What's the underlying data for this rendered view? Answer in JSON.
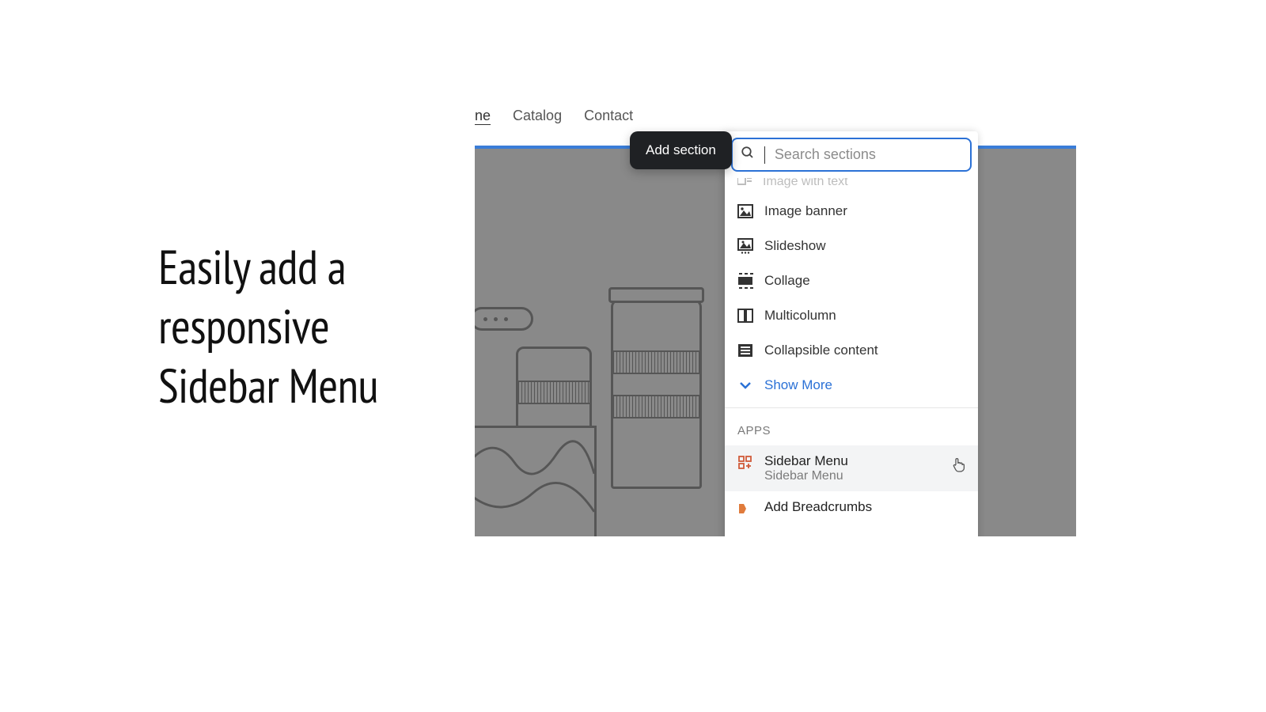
{
  "headline": "Easily add a\nresponsive\nSidebar Menu",
  "nav": {
    "items": [
      {
        "label": "ne",
        "active": true
      },
      {
        "label": "Catalog",
        "active": false
      },
      {
        "label": "Contact",
        "active": false
      }
    ]
  },
  "add_section_label": "Add section",
  "search": {
    "placeholder": "Search sections",
    "value": ""
  },
  "peek_item": {
    "label": "Image with text"
  },
  "sections": [
    {
      "label": "Image banner",
      "icon": "image-icon"
    },
    {
      "label": "Slideshow",
      "icon": "slideshow-icon"
    },
    {
      "label": "Collage",
      "icon": "collage-icon"
    },
    {
      "label": "Multicolumn",
      "icon": "multicolumn-icon"
    },
    {
      "label": "Collapsible content",
      "icon": "collapsible-icon"
    }
  ],
  "show_more_label": "Show More",
  "apps_label": "APPS",
  "apps": [
    {
      "title": "Sidebar Menu",
      "subtitle": "Sidebar Menu",
      "highlighted": true,
      "icon": "app-sidebar-icon"
    },
    {
      "title": "Add Breadcrumbs",
      "subtitle": "",
      "highlighted": false,
      "icon": "app-breadcrumbs-icon"
    }
  ]
}
